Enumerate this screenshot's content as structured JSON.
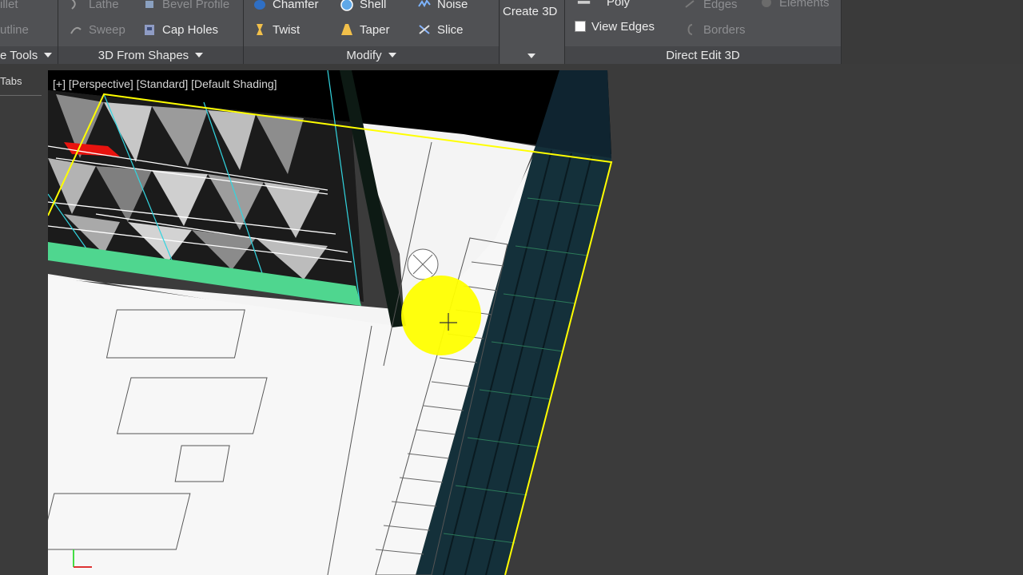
{
  "ribbon": {
    "row1": {
      "lathe": "Lathe",
      "bevel_profile": "Bevel Profile",
      "chamfer": "Chamfer",
      "shell": "Shell",
      "noise": "Noise",
      "poly": "Poly",
      "edges": "Edges",
      "elements": "Elements",
      "fillet": "illet"
    },
    "row2": {
      "outline": "utline",
      "sweep": "Sweep",
      "cap_holes": "Cap Holes",
      "twist": "Twist",
      "taper": "Taper",
      "slice": "Slice",
      "view_edges": "View Edges",
      "borders": "Borders"
    },
    "create_3d": "Create 3D",
    "panels": {
      "shape_tools": "e Tools",
      "from_shapes": "3D From Shapes",
      "modify": "Modify",
      "direct_edit": "Direct Edit 3D"
    }
  },
  "left": {
    "tabs_label": "Tabs"
  },
  "viewport": {
    "label": "[+] [Perspective] [Standard] [Default Shading]"
  },
  "colors": {
    "ribbon_bg": "#4a4b4e",
    "viewport_bg": "#3b3b3b",
    "selection_yellow": "#ffff00",
    "floor_white": "#f7f7f7",
    "facade_green": "#17323a",
    "accent_mint": "#4fd68f",
    "accent_red": "#e8130f",
    "edge_cyan": "#32d5e0"
  },
  "icons": {
    "lathe": "lathe-icon",
    "bevel": "bevel-icon",
    "chamfer": "chamfer-icon",
    "shell": "shell-icon",
    "noise": "noise-icon",
    "sweep": "sweep-icon",
    "cap_holes": "cap-holes-icon",
    "twist": "twist-icon",
    "taper": "taper-icon",
    "slice": "slice-icon"
  }
}
